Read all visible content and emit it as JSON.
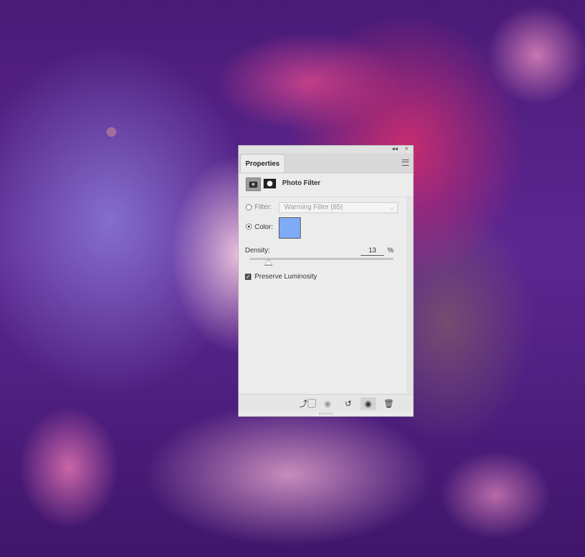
{
  "panel": {
    "tab_label": "Properties",
    "collapse_glyph": "◂◂",
    "close_glyph": "×",
    "adjustment_title": "Photo Filter",
    "filter_label": "Filter:",
    "filter_value": "Warming Filter (85)",
    "color_label": "Color:",
    "selected_mode": "color",
    "color_swatch": "#7faaf5",
    "density_label": "Density:",
    "density_value": "13",
    "density_unit": "%",
    "density_fraction": 0.13,
    "preserve_label": "Preserve Luminosity",
    "preserve_checked": true
  },
  "footer": {
    "clip_icon": "clip-to-layer-icon",
    "view_previous_icon": "view-previous-state-icon",
    "reset_icon": "reset-icon",
    "visibility_icon": "eye-icon",
    "delete_icon": "trash-icon"
  },
  "colors": {
    "panel_bg": "#ececec",
    "swatch": "#7faaf5",
    "background_accent": "#5d2792"
  }
}
